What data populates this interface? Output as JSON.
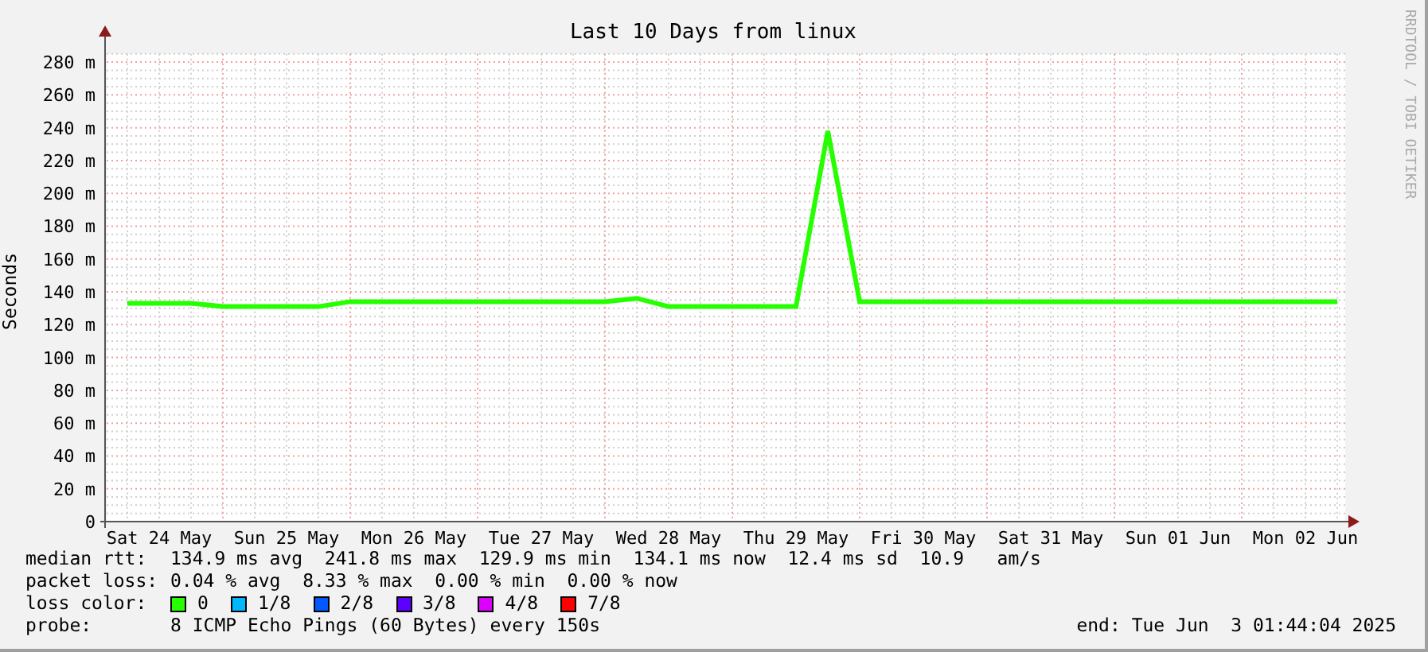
{
  "credit": "RRDTOOL / TOBI OETIKER",
  "chart_data": {
    "type": "line",
    "title": "Last 10 Days from linux",
    "ylabel": "Seconds",
    "categories": [
      null,
      "Sat 24 May",
      null,
      null,
      null,
      "Sun 25 May",
      null,
      null,
      null,
      "Mon 26 May",
      null,
      null,
      null,
      "Tue 27 May",
      null,
      null,
      null,
      "Wed 28 May",
      null,
      null,
      null,
      "Thu 29 May",
      null,
      null,
      null,
      "Fri 30 May",
      null,
      null,
      null,
      "Sat 31 May",
      null,
      null,
      null,
      "Sun 01 Jun",
      null,
      null,
      null,
      "Mon 02 Jun",
      null
    ],
    "series": [
      {
        "name": "median rtt:",
        "color": "#26ff00",
        "values": [
          133,
          133,
          133,
          131,
          131,
          131,
          131,
          134,
          134,
          134,
          134,
          134,
          134,
          134,
          134,
          134,
          136,
          131,
          131,
          131,
          131,
          131,
          238,
          134,
          134,
          134,
          134,
          134,
          134,
          134,
          134,
          134,
          134,
          134,
          134,
          134,
          134,
          134,
          134
        ]
      }
    ],
    "ylim": [
      0,
      285
    ],
    "grid": true,
    "yticks": [
      {
        "value": 0,
        "label": "0"
      },
      {
        "value": 20,
        "label": "20 m"
      },
      {
        "value": 40,
        "label": "40 m"
      },
      {
        "value": 60,
        "label": "60 m"
      },
      {
        "value": 80,
        "label": "80 m"
      },
      {
        "value": 100,
        "label": "100 m"
      },
      {
        "value": 120,
        "label": "120 m"
      },
      {
        "value": 140,
        "label": "140 m"
      },
      {
        "value": 160,
        "label": "160 m"
      },
      {
        "value": 180,
        "label": "180 m"
      },
      {
        "value": 200,
        "label": "200 m"
      },
      {
        "value": 220,
        "label": "220 m"
      },
      {
        "value": 240,
        "label": "240 m"
      },
      {
        "value": 260,
        "label": "260 m"
      },
      {
        "value": 280,
        "label": "280 m"
      }
    ],
    "xlabel": null
  },
  "stats": [
    {
      "text": "134.9 ms avg  241.8 ms max  129.9 ms min  134.1 ms now  12.4 ms sd  10.9   am/s"
    },
    {
      "label": "packet loss:",
      "text": "0.04 % avg  8.33 % max  0.00 % min  0.00 % now"
    }
  ],
  "loss_colors": {
    "label": "loss color:",
    "items": [
      {
        "label": "0",
        "color": "#26ff00"
      },
      {
        "label": "1/8",
        "color": "#00b8ff"
      },
      {
        "label": "2/8",
        "color": "#0059ff"
      },
      {
        "label": "3/8",
        "color": "#5e00ff"
      },
      {
        "label": "4/8",
        "color": "#dd00ff"
      },
      {
        "label": "7/8",
        "color": "#ff0000"
      }
    ]
  },
  "probe": {
    "label": "probe:",
    "text": "8 ICMP Echo Pings (60 Bytes) every 150s"
  },
  "end": "end: Tue Jun  3 01:44:04 2025"
}
